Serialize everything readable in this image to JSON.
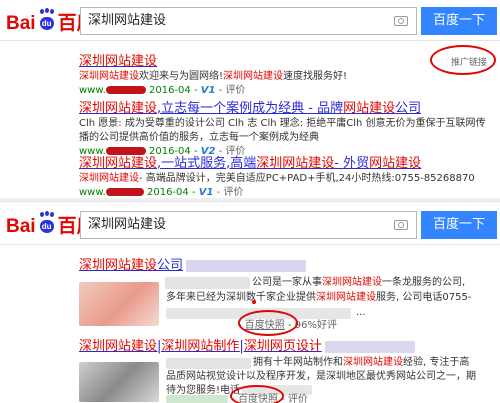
{
  "top": {
    "logo": {
      "text": "Bai",
      "paw": "du",
      "cn": "百度"
    },
    "query": "深圳网站建设",
    "button": "百度一下",
    "ad_label": "推广链接",
    "results": [
      {
        "title": [
          "深圳网站建设"
        ],
        "desc": [
          "深圳网站建设",
          "欢迎来与为圆网络!",
          "深圳网站建设",
          "速度找服务好!"
        ],
        "url": "www.",
        "date": "2016-04",
        "v": "V1",
        "rate": "评价"
      },
      {
        "title": [
          "深圳网站建设",
          ",立志每一个案例成为经典 - 品牌",
          "网站建设",
          "公司"
        ],
        "desc": [
          "Clh 愿景: 成为受尊重的设计公司 Clh 志 Clh 理念: 拒绝平庸Clh 创意无价为重保于互联网传",
          "播的公司提供高价值的服务，立志每一个案例成为经典"
        ],
        "url": "www.",
        "date": "2016-04",
        "v": "V2",
        "rate": "评价"
      },
      {
        "title": [
          "深圳网站建设",
          ",一站式服务,高端",
          "深圳网站建设",
          "- 外贸",
          "网站建设"
        ],
        "desc": [
          "深圳网站建设",
          "- 高端品牌设计，完美自适应PC+PAD+手机,24小时热线:0755-85268870"
        ],
        "url": "www.",
        "date": "2016-04",
        "v": "V1",
        "rate": "评价"
      }
    ]
  },
  "bottom": {
    "logo": {
      "text": "Bai",
      "paw": "du",
      "cn": "百度"
    },
    "query": "深圳网站建设",
    "button": "百度一下",
    "results": [
      {
        "title": [
          "深圳网站建设",
          "公司"
        ],
        "desc": [
          "公司是一家从事",
          "深圳网站建设",
          "一条龙服务的公司,",
          "多年来已经为深圳数千家企业提供",
          "深圳网站建设",
          "服务, 公司电话0755-",
          "..."
        ],
        "snap": "百度快照",
        "good": "96%好评"
      },
      {
        "title": [
          "深圳网站建设",
          "|",
          "深圳网站制作",
          "|",
          "深圳网页设计"
        ],
        "desc": [
          "拥有十年网站制作和",
          "深圳网站建设",
          "经验, 专注于高",
          "品质网站视觉设计以及程序开发，是深圳地区最优秀网站公司之一，期",
          "待为您服务!电话"
        ],
        "snap": "百度快照",
        "rate": "评价"
      }
    ]
  },
  "colors": {
    "brand_red": "#e10601",
    "link_blue": "#2b2bd6",
    "url_green": "#008000",
    "button_blue": "#3385ff"
  }
}
